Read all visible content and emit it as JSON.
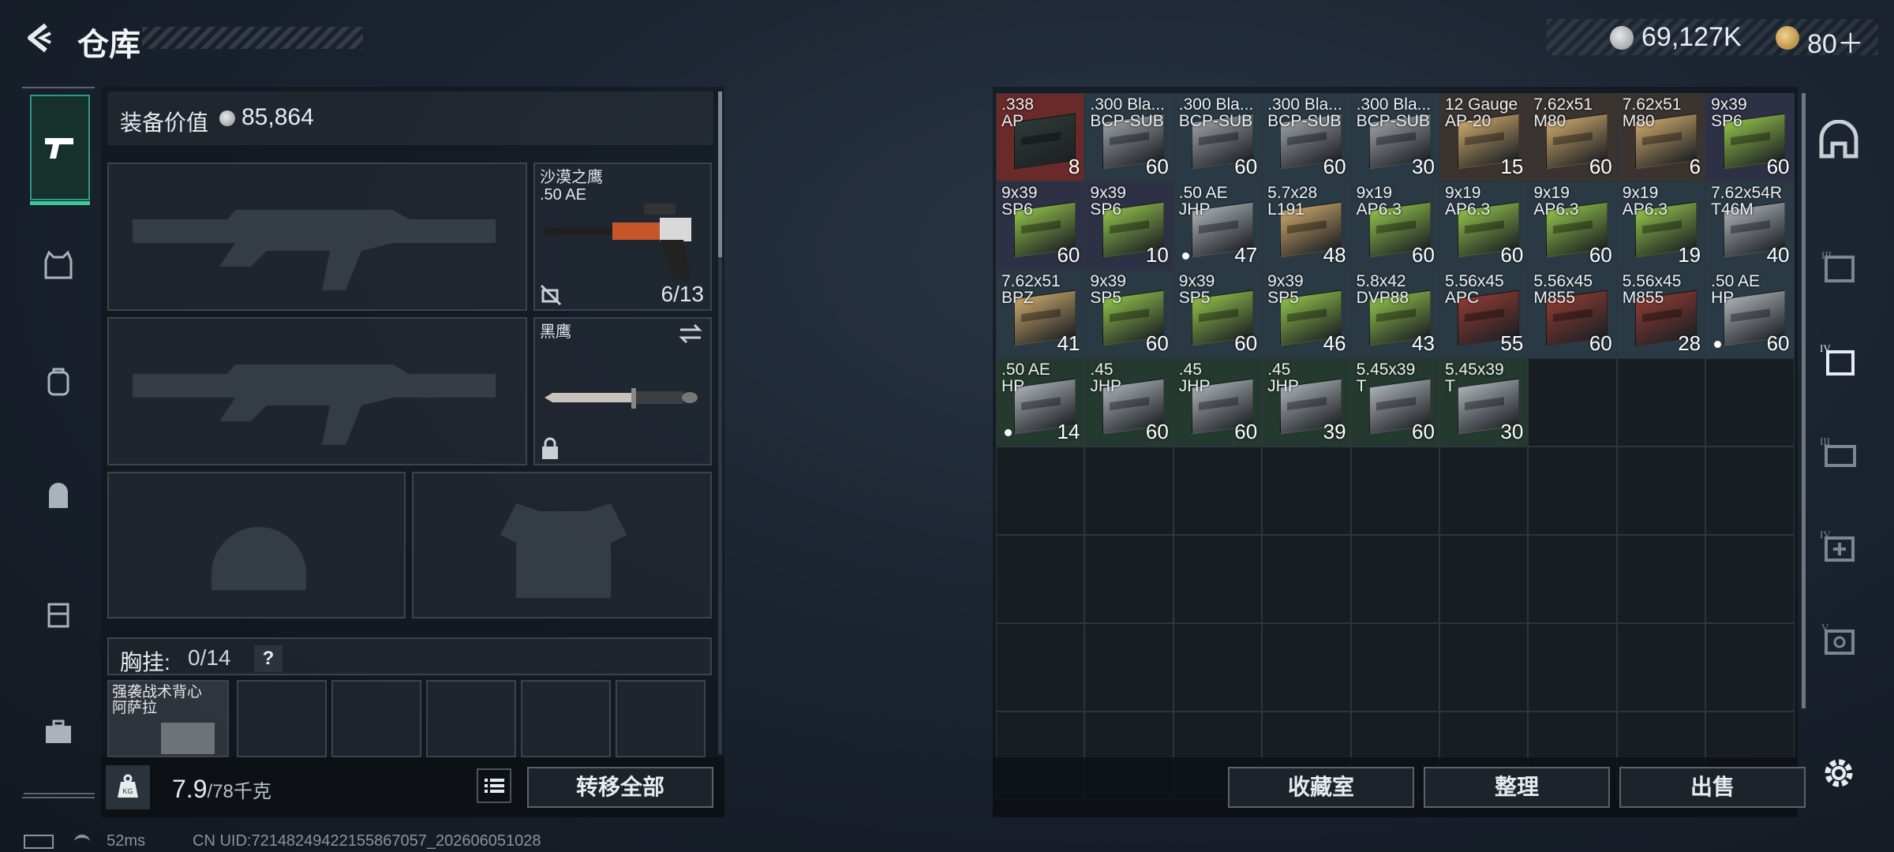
{
  "header": {
    "title": "仓库",
    "silver_amount": "69,127K",
    "gold_amount": "80＋"
  },
  "equipment": {
    "value_label": "装备价值",
    "value": "85,864",
    "pistol_name": "沙漠之鹰",
    "pistol_caliber": ".50 AE",
    "pistol_ammo": "6/13",
    "melee_name": "黑鹰",
    "chest_label": "胸挂:",
    "chest_capacity": "0/14",
    "chest_help": "?",
    "vest_name": "强袭战术背心\n阿萨拉"
  },
  "footer_left": {
    "weight": "7.9",
    "weight_cap": "/78千克",
    "weight_icon": "KG",
    "transfer_all": "转移全部"
  },
  "footer_right": {
    "collection": "收藏室",
    "sort": "整理",
    "sell": "出售"
  },
  "status": {
    "ping": "52ms",
    "uid": "CN UID:72148249422155867057_202606051028"
  },
  "right_tabs": [
    "III",
    "IV",
    "III",
    "IV",
    "V"
  ],
  "colors": {
    "accent_green": "#3fc79a",
    "ammo_green": "#8fbf4a",
    "ammo_tan": "#c9a66b",
    "ammo_silver": "#a9afb5",
    "ammo_red": "#8e3b33"
  },
  "inventory": [
    {
      "label": ".338\nAP",
      "count": "8",
      "color": "#2d3b36",
      "bg": "#6a2a2a"
    },
    {
      "label": ".300 Bla...\nBCP-SUB",
      "count": "60",
      "color": "#9aa0a6",
      "bg": "#2a3a45"
    },
    {
      "label": ".300 Bla...\nBCP-SUB",
      "count": "60",
      "color": "#9aa0a6",
      "bg": "#2a3a45"
    },
    {
      "label": ".300 Bla...\nBCP-SUB",
      "count": "60",
      "color": "#9aa0a6",
      "bg": "#2a3a45"
    },
    {
      "label": ".300 Bla...\nBCP-SUB",
      "count": "30",
      "color": "#9aa0a6",
      "bg": "#2a3a45"
    },
    {
      "label": "12 Gauge\nAP-20",
      "count": "15",
      "color": "#c9a66b",
      "bg": "#3a3330"
    },
    {
      "label": "7.62x51\nM80",
      "count": "60",
      "color": "#c9a66b",
      "bg": "#3a3330"
    },
    {
      "label": "7.62x51\nM80",
      "count": "6",
      "color": "#c9a66b",
      "bg": "#3a3330"
    },
    {
      "label": "9x39\nSP6",
      "count": "60",
      "color": "#8fbf4a",
      "bg": "#2e3145"
    },
    {
      "label": "9x39\nSP6",
      "count": "60",
      "color": "#8fbf4a",
      "bg": "#2e3145"
    },
    {
      "label": "9x39\nSP6",
      "count": "10",
      "color": "#8fbf4a",
      "bg": "#2e3145"
    },
    {
      "label": ".50 AE\nJHP",
      "count": "47",
      "color": "#a9afb5",
      "bg": "#2a3a45",
      "dot": true
    },
    {
      "label": "5.7x28\nL191",
      "count": "48",
      "color": "#c9a66b",
      "bg": "#2a3a45"
    },
    {
      "label": "9x19\nAP6.3",
      "count": "60",
      "color": "#8fbf4a",
      "bg": "#2a3a45"
    },
    {
      "label": "9x19\nAP6.3",
      "count": "60",
      "color": "#8fbf4a",
      "bg": "#2a3a45"
    },
    {
      "label": "9x19\nAP6.3",
      "count": "60",
      "color": "#8fbf4a",
      "bg": "#2a3a45"
    },
    {
      "label": "9x19\nAP6.3",
      "count": "19",
      "color": "#8fbf4a",
      "bg": "#2a3a45"
    },
    {
      "label": "7.62x54R\nT46M",
      "count": "40",
      "color": "#a9afb5",
      "bg": "#2a3a45"
    },
    {
      "label": "7.62x51\nBPZ",
      "count": "41",
      "color": "#c9a66b",
      "bg": "#2a3a45"
    },
    {
      "label": "9x39\nSP5",
      "count": "60",
      "color": "#8fbf4a",
      "bg": "#2a3a45"
    },
    {
      "label": "9x39\nSP5",
      "count": "60",
      "color": "#8fbf4a",
      "bg": "#2a3a45"
    },
    {
      "label": "9x39\nSP5",
      "count": "46",
      "color": "#8fbf4a",
      "bg": "#2a3a45"
    },
    {
      "label": "5.8x42\nDVP88",
      "count": "43",
      "color": "#8fbf4a",
      "bg": "#2a3a45"
    },
    {
      "label": "5.56x45\nAPC",
      "count": "55",
      "color": "#8e3b33",
      "bg": "#2a3a45"
    },
    {
      "label": "5.56x45\nM855",
      "count": "60",
      "color": "#8e3b33",
      "bg": "#2a3a45"
    },
    {
      "label": "5.56x45\nM855",
      "count": "28",
      "color": "#8e3b33",
      "bg": "#2a3a45"
    },
    {
      "label": ".50 AE\nHP",
      "count": "60",
      "color": "#a9afb5",
      "bg": "#2a3a45",
      "dot": true
    },
    {
      "label": ".50 AE\nHP",
      "count": "14",
      "color": "#a9afb5",
      "bg": "#243a2e",
      "dot": true
    },
    {
      "label": ".45\nJHP",
      "count": "60",
      "color": "#a9afb5",
      "bg": "#243a2e"
    },
    {
      "label": ".45\nJHP",
      "count": "60",
      "color": "#a9afb5",
      "bg": "#243a2e"
    },
    {
      "label": ".45\nJHP",
      "count": "39",
      "color": "#a9afb5",
      "bg": "#243a2e"
    },
    {
      "label": "5.45x39\nT",
      "count": "60",
      "color": "#a9afb5",
      "bg": "#243a2e"
    },
    {
      "label": "5.45x39\nT",
      "count": "30",
      "color": "#a9afb5",
      "bg": "#243a2e"
    }
  ],
  "empty_slots": 39
}
